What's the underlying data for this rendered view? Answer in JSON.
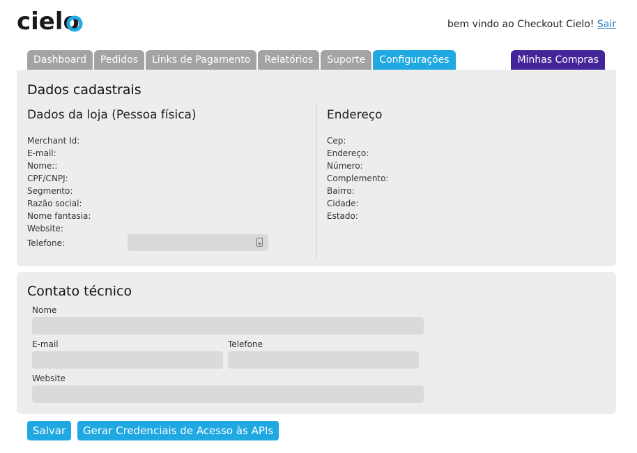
{
  "header": {
    "logo_text": "cielo",
    "welcome_text": "bem vindo ao Checkout Cielo!",
    "logout_label": "Sair"
  },
  "tabs": [
    {
      "label": "Dashboard"
    },
    {
      "label": "Pedidos"
    },
    {
      "label": "Links de Pagamento"
    },
    {
      "label": "Relatórios"
    },
    {
      "label": "Suporte"
    },
    {
      "label": "Configurações"
    }
  ],
  "active_tab": "Configurações",
  "minhas_compras_label": "Minhas Compras",
  "dados_cadastrais": {
    "title": "Dados cadastrais",
    "loja": {
      "title": "Dados da loja (Pessoa física)",
      "fields": [
        "Merchant Id:",
        "E-mail:",
        "Nome::",
        "CPF/CNPJ:",
        "Segmento:",
        "Razão social:",
        "Nome fantasia:",
        "Website:"
      ],
      "telefone_label": "Telefone:",
      "telefone_value": ""
    },
    "endereco": {
      "title": "Endereço",
      "fields": [
        "Cep:",
        "Endereço:",
        "Número:",
        "Complemento:",
        "Bairro:",
        "Cidade:",
        "Estado:"
      ]
    }
  },
  "contato_tecnico": {
    "title": "Contato técnico",
    "nome_label": "Nome",
    "nome_value": "",
    "email_label": "E-mail",
    "email_value": "",
    "telefone_label": "Telefone",
    "telefone_value": "",
    "website_label": "Website",
    "website_value": ""
  },
  "buttons": {
    "salvar": "Salvar",
    "gerar": "Gerar Credenciais de Acesso às APIs"
  },
  "colors": {
    "tab_inactive": "#a3a3a3",
    "tab_active": "#1fa8e2",
    "minhas_compras": "#43259a",
    "panel_bg": "#ededed",
    "input_bg": "#dadada",
    "button": "#1fa8e2",
    "link": "#2b7bb9"
  }
}
